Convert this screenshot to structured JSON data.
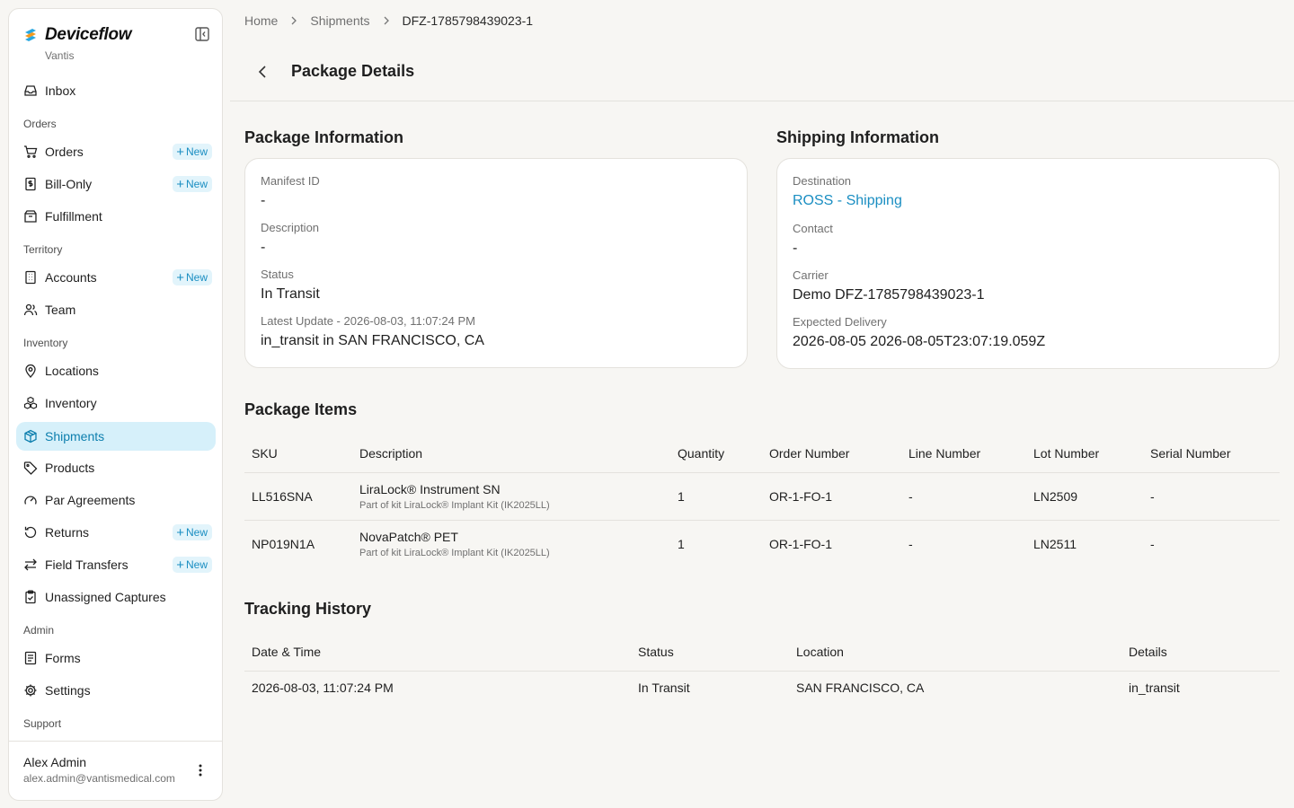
{
  "app": {
    "name": "Deviceflow",
    "org": "Vantis"
  },
  "sidebar": {
    "sections": {
      "orders": "Orders",
      "territory": "Territory",
      "inventory": "Inventory",
      "admin": "Admin",
      "support": "Support"
    },
    "new_label": "New",
    "items": {
      "inbox": "Inbox",
      "orders": "Orders",
      "bill_only": "Bill-Only",
      "fulfillment": "Fulfillment",
      "accounts": "Accounts",
      "team": "Team",
      "locations": "Locations",
      "inventory": "Inventory",
      "shipments": "Shipments",
      "products": "Products",
      "par_agreements": "Par Agreements",
      "returns": "Returns",
      "field_transfers": "Field Transfers",
      "unassigned_captures": "Unassigned Captures",
      "forms": "Forms",
      "settings": "Settings"
    },
    "active_item": "shipments"
  },
  "user": {
    "name": "Alex Admin",
    "email": "alex.admin@vantismedical.com"
  },
  "breadcrumb": [
    "Home",
    "Shipments",
    "DFZ-1785798439023-1"
  ],
  "page": {
    "title": "Package Details"
  },
  "package_info": {
    "title": "Package Information",
    "manifest_label": "Manifest ID",
    "manifest_value": "-",
    "description_label": "Description",
    "description_value": "-",
    "status_label": "Status",
    "status_value": "In Transit",
    "update_label": "Latest Update - 2026-08-03, 11:07:24 PM",
    "update_value": "in_transit in SAN FRANCISCO, CA"
  },
  "shipping_info": {
    "title": "Shipping Information",
    "destination_label": "Destination",
    "destination_value": "ROSS - Shipping",
    "contact_label": "Contact",
    "contact_value": "-",
    "carrier_label": "Carrier",
    "carrier_value": "Demo DFZ-1785798439023-1",
    "delivery_label": "Expected Delivery",
    "delivery_value": "2026-08-05 2026-08-05T23:07:19.059Z"
  },
  "package_items": {
    "title": "Package Items",
    "columns": [
      "SKU",
      "Description",
      "Quantity",
      "Order Number",
      "Line Number",
      "Lot Number",
      "Serial Number"
    ],
    "rows": [
      {
        "sku": "LL516SNA",
        "description": "LiraLock® Instrument SN",
        "kit": "Part of kit LiraLock® Implant Kit (IK2025LL)",
        "quantity": "1",
        "order_number": "OR-1-FO-1",
        "line_number": "-",
        "lot_number": "LN2509",
        "serial_number": "-"
      },
      {
        "sku": "NP019N1A",
        "description": "NovaPatch® PET",
        "kit": "Part of kit LiraLock® Implant Kit (IK2025LL)",
        "quantity": "1",
        "order_number": "OR-1-FO-1",
        "line_number": "-",
        "lot_number": "LN2511",
        "serial_number": "-"
      }
    ]
  },
  "tracking_history": {
    "title": "Tracking History",
    "columns": [
      "Date & Time",
      "Status",
      "Location",
      "Details"
    ],
    "rows": [
      {
        "datetime": "2026-08-03, 11:07:24 PM",
        "status": "In Transit",
        "location": "SAN FRANCISCO, CA",
        "details": "in_transit"
      }
    ]
  },
  "colors": {
    "accent": "#1a8ec2",
    "active_bg": "#d6f0fa",
    "background": "#f7f6f3",
    "logo_blue": "#2aa8e0",
    "logo_orange": "#f39a1e"
  },
  "icons": {
    "brand": "deviceflow-logo-icon",
    "collapse": "sidebar-collapse-icon",
    "inbox": "inbox-icon",
    "orders": "cart-icon",
    "bill_only": "invoice-dollar-icon",
    "fulfillment": "box-open-icon",
    "accounts": "building-icon",
    "team": "users-icon",
    "locations": "map-pin-icon",
    "inventory": "boxes-icon",
    "shipments": "package-icon",
    "products": "tag-icon",
    "par_agreements": "gauge-icon",
    "returns": "rotate-ccw-icon",
    "field_transfers": "arrows-left-right-icon",
    "unassigned_captures": "clipboard-check-icon",
    "forms": "file-text-icon",
    "settings": "gear-icon",
    "user_menu": "more-vertical-icon",
    "back": "chevron-left-icon",
    "breadcrumb_sep": "chevron-right-icon"
  }
}
